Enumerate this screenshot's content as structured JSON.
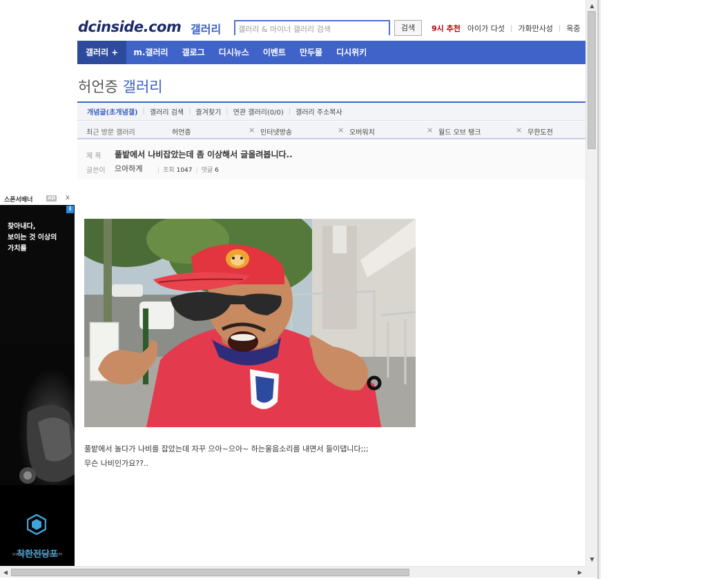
{
  "header": {
    "logo": "dcinside.com",
    "logo_suffix": "갤러리",
    "search_placeholder": "갤러리 & 마이너 갤러리 검색",
    "search_button": "검색",
    "links": [
      "9시 추천",
      "아이가 다섯",
      "가화만사성",
      "옥중"
    ]
  },
  "nav": {
    "items": [
      "갤러리 +",
      "m.갤러리",
      "갤로그",
      "디시뉴스",
      "이벤트",
      "만두몰",
      "디시위키"
    ]
  },
  "gallery": {
    "name": "허언증",
    "suffix": "갤러리"
  },
  "tabs": {
    "items": [
      "개념글(초개념갤)",
      "갤러리 검색",
      "즐겨찾기",
      "연관 갤러리(0/0)",
      "갤러리 주소복사"
    ]
  },
  "recent": {
    "label": "최근 방문 갤러리",
    "galleries": [
      "허언증",
      "인터넷방송",
      "오버워치",
      "월드 오브 탱크",
      "무한도전"
    ]
  },
  "post": {
    "title_label": "제 목",
    "title": "풀밭에서 나비잡았는데 좀 이상해서 글올려봅니다..",
    "writer_label": "글쓴이",
    "writer": "으아하게",
    "views_label": "조회",
    "views": "1047",
    "comments_label": "댓글",
    "comments": "6",
    "body_lines": [
      "풀밭에서 놀다가 나비를 잡았는데 자꾸 으아~으아~ 하는울음소리를 내면서 들이댑니다;;;",
      "무슨 나비인가요??.."
    ]
  },
  "sponsor": {
    "label": "스폰서배너",
    "ad_tag": "AD",
    "close": "x",
    "info": "i",
    "copy": "찾아내다,\n보이는 것 이상의\n가치를",
    "brand": "착한전당포",
    "brand_url": "WWW.GOODPAWNSHOP.COM"
  },
  "colors": {
    "nav_blue": "#4063c9",
    "nav_dark": "#2e4a9c",
    "accent": "#3b5fc4",
    "hot_red": "#b40000"
  }
}
